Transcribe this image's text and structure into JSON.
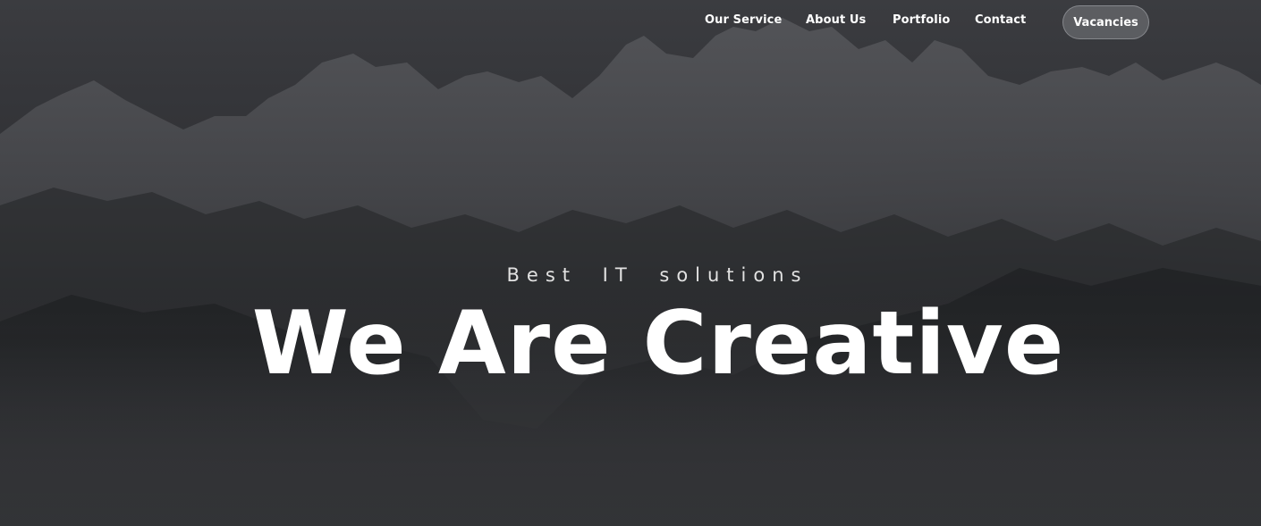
{
  "nav": {
    "items": [
      {
        "label": "Our Service"
      },
      {
        "label": "About Us"
      },
      {
        "label": "Portfolio"
      },
      {
        "label": "Contact"
      }
    ],
    "cta_label": "Vacancies"
  },
  "hero": {
    "subtitle": "Best IT solutions",
    "headline": "We Are Creative",
    "background_image": "dark-mountain-range-with-fog"
  },
  "colors": {
    "background": "#2b2c2f",
    "text": "#ffffff",
    "subtitle": "#e2e2e2"
  }
}
